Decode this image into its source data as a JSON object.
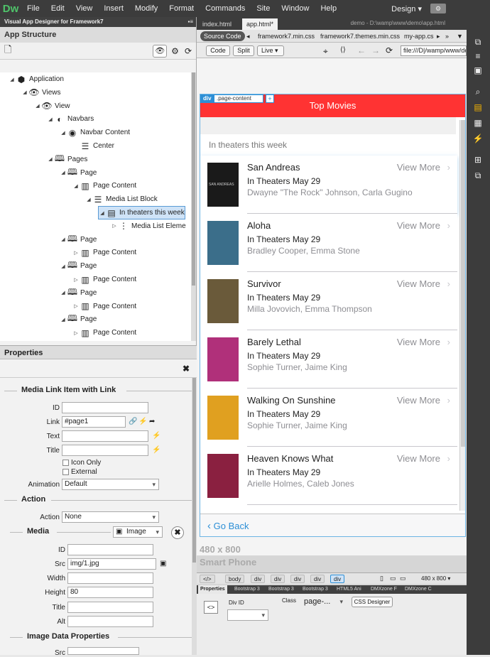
{
  "app": {
    "logo": "Dw",
    "menus": [
      "File",
      "Edit",
      "View",
      "Insert",
      "Modify",
      "Format",
      "Commands",
      "Site",
      "Window",
      "Help"
    ],
    "workspace": "Design"
  },
  "left": {
    "panel_title": "Visual App Designer for Framework7",
    "structure_title": "App Structure",
    "tree": [
      {
        "label": "Application",
        "icon": "application-icon",
        "indent": 0,
        "arrow": "▲"
      },
      {
        "label": "Views",
        "icon": "eye-icon",
        "indent": 1,
        "arrow": "▲"
      },
      {
        "label": "View",
        "icon": "eye-icon",
        "indent": 2,
        "arrow": "▲"
      },
      {
        "label": "Navbars",
        "icon": "navbar-icon",
        "indent": 3,
        "arrow": "▲"
      },
      {
        "label": "Navbar Content",
        "icon": "compass-icon",
        "indent": 4,
        "arrow": "▲"
      },
      {
        "label": "Center",
        "icon": "align-center-icon",
        "indent": 5,
        "arrow": ""
      },
      {
        "label": "Pages",
        "icon": "book-icon",
        "indent": 3,
        "arrow": "▲"
      },
      {
        "label": "Page",
        "icon": "book-icon",
        "indent": 4,
        "arrow": "▲"
      },
      {
        "label": "Page Content",
        "icon": "page-content-icon",
        "indent": 5,
        "arrow": "▲"
      },
      {
        "label": "Media List Block",
        "icon": "list-icon",
        "indent": 6,
        "arrow": "▲"
      },
      {
        "label": "In theaters this week",
        "icon": "list-block-icon",
        "indent": 7,
        "arrow": "▲",
        "selected": true
      },
      {
        "label": "Media List Eleme",
        "icon": "vertical-dots-icon",
        "indent": 8,
        "arrow": "▷"
      },
      {
        "label": "Page",
        "icon": "book-icon",
        "indent": 4,
        "arrow": "▲"
      },
      {
        "label": "Page Content",
        "icon": "page-content-icon",
        "indent": 5,
        "arrow": "▷"
      },
      {
        "label": "Page",
        "icon": "book-icon",
        "indent": 4,
        "arrow": "▲"
      },
      {
        "label": "Page Content",
        "icon": "page-content-icon",
        "indent": 5,
        "arrow": "▷"
      },
      {
        "label": "Page",
        "icon": "book-icon",
        "indent": 4,
        "arrow": "▲"
      },
      {
        "label": "Page Content",
        "icon": "page-content-icon",
        "indent": 5,
        "arrow": "▷"
      },
      {
        "label": "Page",
        "icon": "book-icon",
        "indent": 4,
        "arrow": "▲"
      },
      {
        "label": "Page Content",
        "icon": "page-content-icon",
        "indent": 5,
        "arrow": "▷"
      }
    ]
  },
  "props": {
    "title": "Properties",
    "section1": "Media Link Item with Link",
    "id_label": "ID",
    "link_label": "Link",
    "link_value": "#page1",
    "text_label": "Text",
    "title_label": "Title",
    "icon_only": "Icon Only",
    "external": "External",
    "animation_label": "Animation",
    "animation_value": "Default",
    "action_section": "Action",
    "action_label": "Action",
    "action_value": "None",
    "media_section": "Media",
    "media_type": "Image",
    "mid_label": "ID",
    "src_label": "Src",
    "src_value": "img/1.jpg",
    "width_label": "Width",
    "height_label": "Height",
    "height_value": "80",
    "mtitle_label": "Title",
    "alt_label": "Alt",
    "image_data_section": "Image Data Properties",
    "src2_label": "Src"
  },
  "center": {
    "tabs": [
      "index.html",
      "app.html*"
    ],
    "path": "demo - D:\\wamp\\www\\demo\\app.html",
    "files": [
      "Source Code",
      "framework7.min.css",
      "framework7.themes.min.css",
      "my-app.cs"
    ],
    "view_buttons": [
      "Code",
      "Split",
      "Live"
    ],
    "url": "file:///D|/wamp/www/de",
    "navbar_title": "Top Movies",
    "div_tag": "div",
    "class_tag": ".page-content",
    "plus": "+",
    "section_label": "In theaters this week",
    "movies": [
      {
        "title": "San Andreas",
        "date": "In Theaters May 29",
        "cast": "Dwayne \"The Rock\" Johnson, Carla Gugino",
        "poster": "#1a1a1a",
        "poster_text": "SAN ANDREAS"
      },
      {
        "title": "Aloha",
        "date": "In Theaters May 29",
        "cast": "Bradley Cooper, Emma Stone",
        "poster": "#3b6e8a",
        "poster_text": ""
      },
      {
        "title": "Survivor",
        "date": "In Theaters May 29",
        "cast": "Milla Jovovich, Emma Thompson",
        "poster": "#6a5a3a",
        "poster_text": ""
      },
      {
        "title": "Barely Lethal",
        "date": "In Theaters May 29",
        "cast": "Sophie Turner, Jaime King",
        "poster": "#b0307a",
        "poster_text": ""
      },
      {
        "title": "Walking On Sunshine",
        "date": "In Theaters May 29",
        "cast": "Sophie Turner, Jaime King",
        "poster": "#e0a020",
        "poster_text": ""
      },
      {
        "title": "Heaven Knows What",
        "date": "In Theaters May 29",
        "cast": "Arielle Holmes, Caleb Jones",
        "poster": "#8a2040",
        "poster_text": ""
      }
    ],
    "view_more": "View More",
    "go_back": "Go Back",
    "resolution": "480 x 800",
    "device": "Smart Phone",
    "tags": [
      "</>",
      "body",
      "div",
      "div",
      "div",
      "div",
      "div"
    ],
    "size_select": "480 x 800",
    "panel_tabs": [
      "Properties",
      "Bootstrap 3",
      "Bootstrap 3",
      "Bootstrap 3",
      "HTML5 Ani",
      "DMXzone F",
      "DMXzone C"
    ],
    "div_id_label": "Div ID",
    "class_label": "Class",
    "class_value": "page-...",
    "css_designer": "CSS Designer"
  },
  "colors": {
    "navbar": "#ff3333",
    "accent": "#2d8fd6"
  }
}
